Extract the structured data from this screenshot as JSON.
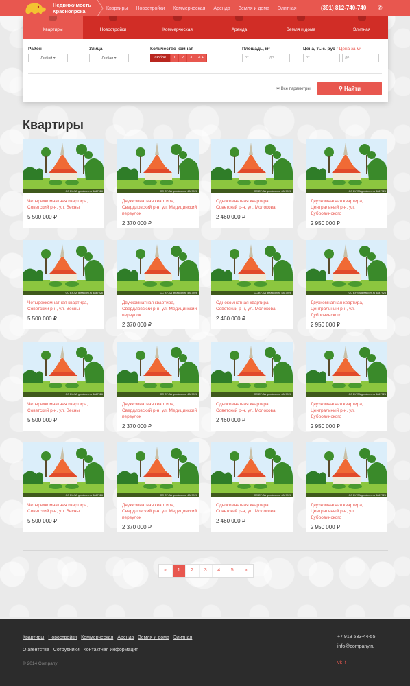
{
  "header": {
    "brand_line1": "Недвижимость",
    "brand_line2": "Красноярска",
    "nav": [
      "Квартиры",
      "Новостройки",
      "Коммерческая",
      "Аренда",
      "Земля и дома",
      "Элитная"
    ],
    "phone": "(391) 812-740-740",
    "accent": "#e8574f"
  },
  "search": {
    "tabs": [
      "Квартиры",
      "Новостройки",
      "Коммерческая",
      "Аренда",
      "Земля и дома",
      "Элитная"
    ],
    "district_label": "Район",
    "district_value": "Любой",
    "street_label": "Улица",
    "street_value": "Любая",
    "rooms_label": "Количество комнат",
    "rooms": [
      "Любое",
      "1",
      "2",
      "3",
      "4 +"
    ],
    "area_label": "Площадь, м²",
    "area_from": "от",
    "area_to": "до",
    "price_label": "Цена, тыс. руб",
    "price_sep": "/",
    "price_alt": "Цена за м²",
    "price_from": "от",
    "price_to": "до",
    "all_params": "Все параметры",
    "find_button": "Найти"
  },
  "page_title": "Квартиры",
  "listings": [
    {
      "title": "Четырехкомнатная квартира, Советский р-н, ул. Весны",
      "price": "5 500 000 ₽",
      "watermark": "CC BY-SA greatcom.ru 4847926"
    },
    {
      "title": "Двухкомнатная квартира, Свердловский р-н, ул. Медицинский переулок",
      "price": "2 370 000 ₽",
      "watermark": "CC BY-SA greatcom.ru 4847926"
    },
    {
      "title": "Однокомнатная квартира, Советский р-н, ул. Молокова",
      "price": "2 460 000 ₽",
      "watermark": "CC BY-SA greatcom.ru 4847926"
    },
    {
      "title": "Двухкомнатная квартира, Центральный р-н, ул. Дубровинского",
      "price": "2 950 000 ₽",
      "watermark": "CC BY-SA greatcom.ru 4847926"
    }
  ],
  "pagination": [
    "«",
    "1",
    "2",
    "3",
    "4",
    "5",
    "»"
  ],
  "footer": {
    "row1": [
      "Квартиры",
      "Новостройки",
      "Коммерческая",
      "Аренда",
      "Земля и дома",
      "Элитная"
    ],
    "row2": [
      "О агентстве",
      "Сотрудники",
      "Контактная информация"
    ],
    "copyright": "© 2014 Company",
    "phone": "+7 913 533-44-55",
    "email": "info@company.ru",
    "social": [
      "vk",
      "f"
    ]
  }
}
